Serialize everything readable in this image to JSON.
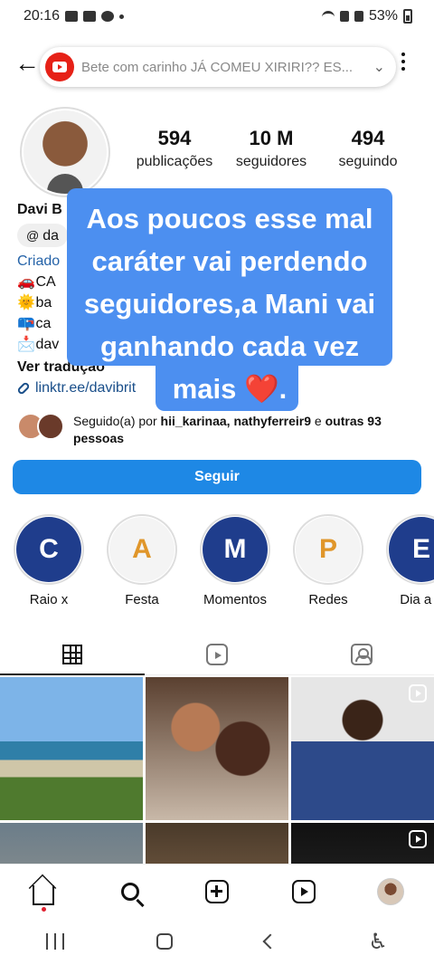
{
  "status": {
    "time": "20:16",
    "battery": "53%"
  },
  "topbar": {
    "search_text": "Bete com carinho  JÁ COMEU XIRIRI?? ES..."
  },
  "profile": {
    "stats": [
      {
        "value": "594",
        "label": "publicações"
      },
      {
        "value": "10 M",
        "label": "seguidores"
      },
      {
        "value": "494",
        "label": "seguindo"
      }
    ],
    "name": "Davi B",
    "threads_handle": "da",
    "category": "Criado",
    "bio_lines": [
      {
        "emoji": "🚗",
        "text": "CA"
      },
      {
        "emoji": "🌞",
        "text": "ba"
      },
      {
        "emoji": "📪",
        "text": "ca"
      },
      {
        "emoji": "📩",
        "text": "dav"
      }
    ],
    "see_translation": "Ver tradução",
    "link": "linktr.ee/davibrit"
  },
  "overlay": {
    "text": "Aos poucos esse mal caráter vai perdendo seguidores,a Mani vai ganhando cada vez mais",
    "heart": "❤️",
    "trail": "."
  },
  "followed_by": {
    "prefix": "Seguido(a) por ",
    "names": "hii_karinaa, nathyferreir9",
    "middle": " e ",
    "others": "outras 93",
    "suffix": "pessoas"
  },
  "follow_button": "Seguir",
  "highlights": [
    {
      "letter": "C",
      "label": "Raio x",
      "bg": "#1f3d8c",
      "fg": "#ffffff"
    },
    {
      "letter": "A",
      "label": "Festa",
      "bg": "#f4f4f4",
      "fg": "#e0962a"
    },
    {
      "letter": "M",
      "label": "Momentos",
      "bg": "#1f3d8c",
      "fg": "#ffffff"
    },
    {
      "letter": "P",
      "label": "Redes",
      "bg": "#f4f4f4",
      "fg": "#e0962a"
    },
    {
      "letter": "E",
      "label": "Dia a d",
      "bg": "#1f3d8c",
      "fg": "#ffffff"
    }
  ],
  "colors": {
    "accent": "#1e88e5",
    "overlay": "#4c8ff0"
  }
}
